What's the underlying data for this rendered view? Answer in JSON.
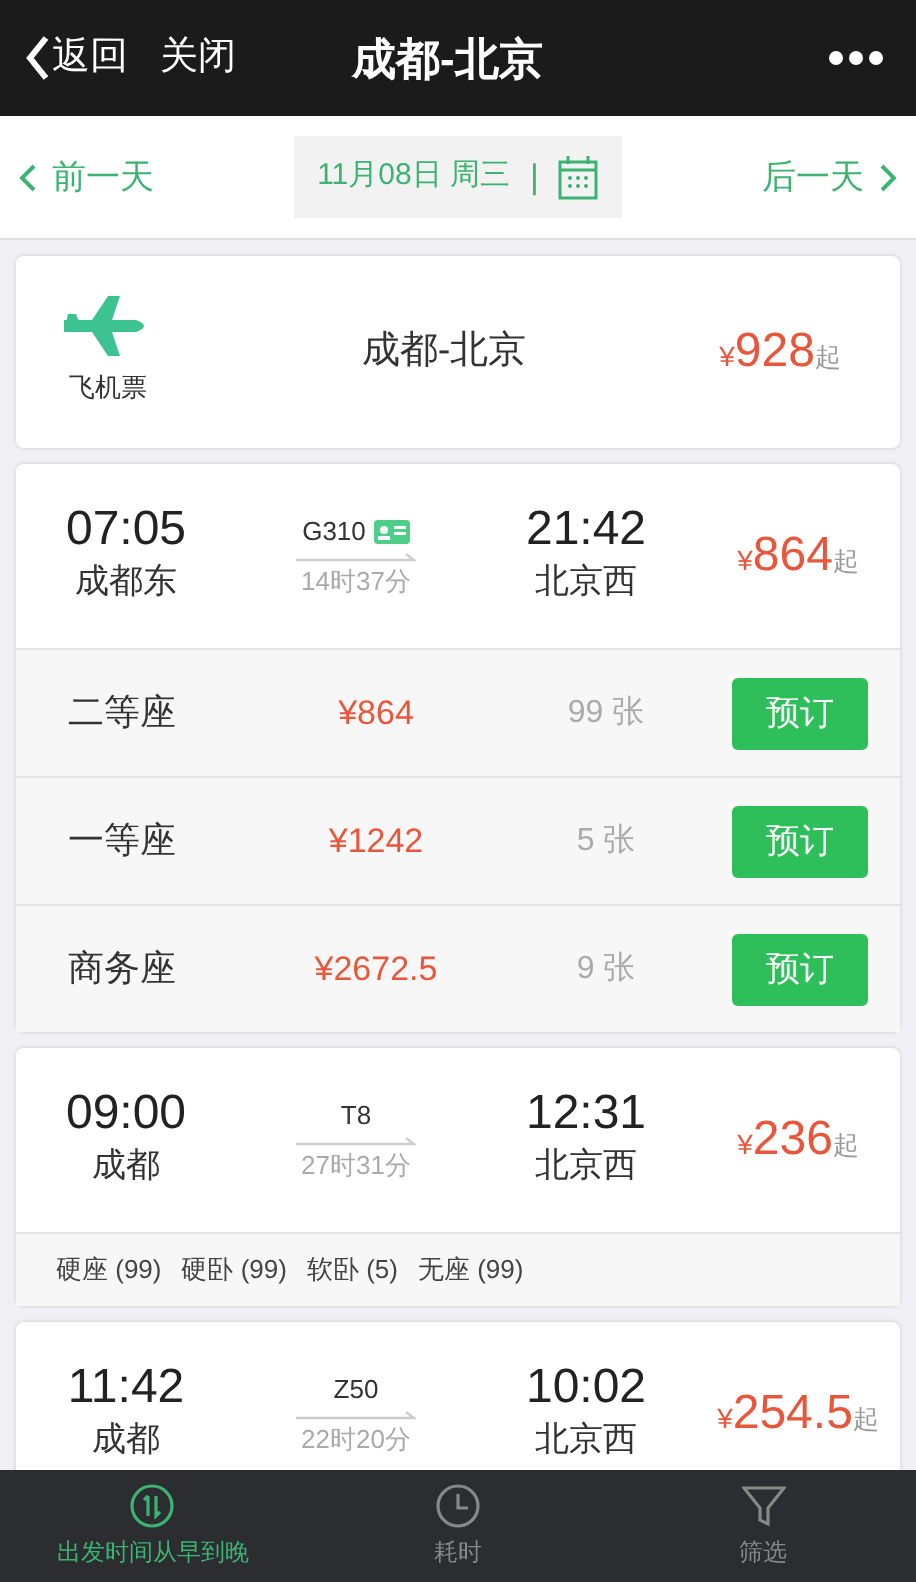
{
  "nav": {
    "back": "返回",
    "close": "关闭",
    "title": "成都-北京"
  },
  "date_bar": {
    "prev": "前一天",
    "date": "11月08日 周三",
    "separator": "|",
    "next": "后一天"
  },
  "flight": {
    "label": "飞机票",
    "route": "成都-北京",
    "currency": "¥",
    "price": "928",
    "suffix": "起"
  },
  "trains": [
    {
      "depart_time": "07:05",
      "depart_station": "成都东",
      "number": "G310",
      "e_ticket": true,
      "duration": "14时37分",
      "arrive_time": "21:42",
      "arrive_station": "北京西",
      "currency": "¥",
      "price": "864",
      "suffix": "起",
      "seats": [
        {
          "name": "二等座",
          "price": "¥864",
          "count": "99 张",
          "button": "预订"
        },
        {
          "name": "一等座",
          "price": "¥1242",
          "count": "5 张",
          "button": "预订"
        },
        {
          "name": "商务座",
          "price": "¥2672.5",
          "count": "9 张",
          "button": "预订"
        }
      ]
    },
    {
      "depart_time": "09:00",
      "depart_station": "成都",
      "number": "T8",
      "e_ticket": false,
      "duration": "27时31分",
      "arrive_time": "12:31",
      "arrive_station": "北京西",
      "currency": "¥",
      "price": "236",
      "suffix": "起",
      "seat_summary": [
        "硬座 (99)",
        "硬卧 (99)",
        "软卧 (5)",
        "无座 (99)"
      ]
    },
    {
      "depart_time": "11:42",
      "depart_station": "成都",
      "number": "Z50",
      "e_ticket": false,
      "duration": "22时20分",
      "arrive_time": "10:02",
      "arrive_station": "北京西",
      "currency": "¥",
      "price": "254.5",
      "suffix": "起"
    }
  ],
  "bottom_tabs": [
    {
      "label": "出发时间从早到晚",
      "selected": true
    },
    {
      "label": "耗时",
      "selected": false
    },
    {
      "label": "筛选",
      "selected": false
    }
  ]
}
